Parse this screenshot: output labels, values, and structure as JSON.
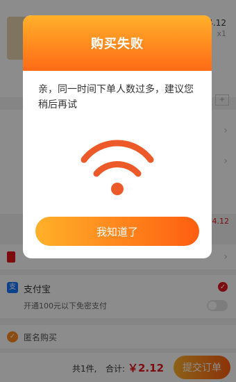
{
  "product": {
    "price": "4.12",
    "qty": "x1"
  },
  "subtotal": "￥4.12",
  "payment": {
    "alipay_label": "支付宝",
    "alipay_icon": "alipay-icon",
    "free_pay_hint": "开通100元以下免密支付"
  },
  "anonymous_label": "匿名购买",
  "footer": {
    "count": "共1件,",
    "total_label": "合计:",
    "total_amount": "￥2.12",
    "submit_label": "提交订单"
  },
  "modal": {
    "title": "购买失败",
    "message": "亲，同一时间下单人数过多，建议您稍后再试",
    "button_label": "我知道了",
    "icon": "wifi-icon"
  },
  "colors": {
    "accent": "#ff6a16",
    "red": "#e4161c"
  }
}
